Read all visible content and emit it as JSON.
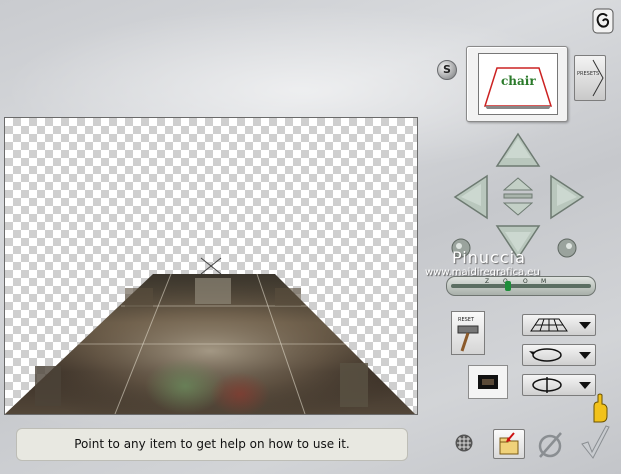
{
  "help": {
    "text": "Point to any item to get help on how to use it."
  },
  "s_button": {
    "label": "S"
  },
  "thumbnail": {
    "caption": "chair"
  },
  "presets": {
    "label": "PRESETS"
  },
  "watermark": {
    "name": "Pinuccia",
    "url": "www.maidiregrafica.eu"
  },
  "zoom": {
    "ticks": [
      "Z",
      "O",
      "O",
      "M"
    ],
    "level": 0.4
  },
  "reset": {
    "label": "RESET"
  },
  "icons": {
    "logo": "c-swirl-logo-icon",
    "arrows": [
      "arrow-up-icon",
      "arrow-left-icon",
      "arrow-right-icon",
      "arrow-down-icon",
      "small-up-icon",
      "small-down-icon"
    ],
    "rotate_left": "rotate-left-icon",
    "rotate_right": "rotate-right-icon",
    "mode1": "perspective-grid-icon",
    "mode2": "ellipse-loop-icon",
    "mode3": "ellipse-axis-icon",
    "grid": "grid-icon",
    "load": "load-folder-icon",
    "cancel": "cancel-icon",
    "ok": "checkmark-icon",
    "help_hand": "pointing-hand-icon"
  },
  "colors": {
    "panel_bg": "#cfd1d4",
    "arrow_fill": "#b9c7bd",
    "checker": "#cfcfcf",
    "zoom_thumb": "#1f8e3a",
    "help_bar": "#e8e8e1"
  }
}
